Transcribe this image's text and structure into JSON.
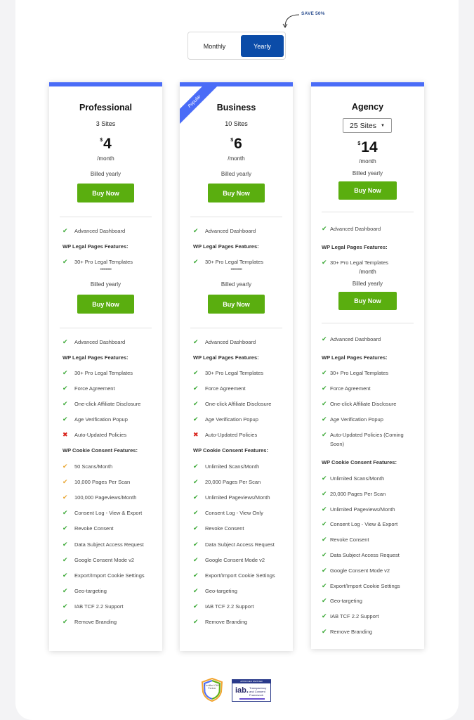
{
  "save_label": "SAVE 50%",
  "toggle": {
    "monthly": "Monthly",
    "yearly": "Yearly",
    "selected": "Yearly"
  },
  "plans": [
    {
      "title": "Professional",
      "sites": "3 Sites",
      "currency": "$",
      "price": "4",
      "per": "/month",
      "billed": "Billed yearly",
      "buy": "Buy Now",
      "preview": {
        "advanced": "Advanced Dashboard",
        "legal_heading": "WP Legal Pages Features:",
        "templates": "30+ Pro Legal Templates",
        "dots": "••••••••••",
        "billed": "Billed yearly",
        "buy": "Buy Now"
      },
      "features": {
        "advanced": "Advanced Dashboard",
        "legal_heading": "WP Legal Pages Features:",
        "legal": [
          {
            "icon": "check",
            "text": "30+ Pro Legal Templates"
          },
          {
            "icon": "check",
            "text": "Force Agreement"
          },
          {
            "icon": "check",
            "text": "One-click Affiliate Disclosure"
          },
          {
            "icon": "check",
            "text": "Age Verification Popup"
          },
          {
            "icon": "cross",
            "text": "Auto-Updated Policies"
          }
        ],
        "cookie_heading": "WP Cookie Consent Features:",
        "cookie": [
          {
            "icon": "partial",
            "text": "50 Scans/Month"
          },
          {
            "icon": "partial",
            "text": "10,000 Pages Per Scan"
          },
          {
            "icon": "partial",
            "text": "100,000 Pageviews/Month"
          },
          {
            "icon": "check",
            "text": "Consent Log - View & Export"
          },
          {
            "icon": "check",
            "text": "Revoke Consent"
          },
          {
            "icon": "check",
            "text": "Data Subject Access Request"
          },
          {
            "icon": "check",
            "text": "Google Consent Mode v2"
          },
          {
            "icon": "check",
            "text": "Export/Import Cookie Settings"
          },
          {
            "icon": "check",
            "text": "Geo-targeting"
          },
          {
            "icon": "check",
            "text": "IAB TCF 2.2 Support"
          },
          {
            "icon": "check",
            "text": "Remove Branding"
          }
        ]
      }
    },
    {
      "title": "Business",
      "ribbon": "Popular",
      "sites": "10 Sites",
      "currency": "$",
      "price": "6",
      "per": "/month",
      "billed": "Billed yearly",
      "buy": "Buy Now",
      "preview": {
        "advanced": "Advanced Dashboard",
        "legal_heading": "WP Legal Pages Features:",
        "templates": "30+ Pro Legal Templates",
        "dots": "••••••••••",
        "billed": "Billed yearly",
        "buy": "Buy Now"
      },
      "features": {
        "advanced": "Advanced Dashboard",
        "legal_heading": "WP Legal Pages Features:",
        "legal": [
          {
            "icon": "check",
            "text": "30+ Pro Legal Templates"
          },
          {
            "icon": "check",
            "text": "Force Agreement"
          },
          {
            "icon": "check",
            "text": "One-click Affiliate Disclosure"
          },
          {
            "icon": "check",
            "text": "Age Verification Popup"
          },
          {
            "icon": "cross",
            "text": "Auto-Updated Policies"
          }
        ],
        "cookie_heading": "WP Cookie Consent Features:",
        "cookie": [
          {
            "icon": "check",
            "text": "Unlimited Scans/Month"
          },
          {
            "icon": "check",
            "text": "20,000 Pages Per Scan"
          },
          {
            "icon": "check",
            "text": "Unlimited Pageviews/Month"
          },
          {
            "icon": "check",
            "text": "Consent Log - View Only"
          },
          {
            "icon": "check",
            "text": "Revoke Consent"
          },
          {
            "icon": "check",
            "text": "Data Subject Access Request"
          },
          {
            "icon": "check",
            "text": "Google Consent Mode v2"
          },
          {
            "icon": "check",
            "text": "Export/Import Cookie Settings"
          },
          {
            "icon": "check",
            "text": "Geo-targeting"
          },
          {
            "icon": "check",
            "text": "IAB TCF 2.2 Support"
          },
          {
            "icon": "check",
            "text": "Remove Branding"
          }
        ]
      }
    },
    {
      "title": "Agency",
      "sites_select": "25 Sites",
      "currency": "$",
      "price": "14",
      "per": "/month",
      "billed": "Billed yearly",
      "buy": "Buy Now",
      "preview": {
        "advanced": "Advanced Dashboard",
        "legal_heading": "WP Legal Pages Features:",
        "templates": "30+ Pro Legal Templates",
        "per": "/month",
        "billed": "Billed yearly",
        "buy": "Buy Now"
      },
      "features": {
        "advanced": "Advanced Dashboard",
        "legal_heading": "WP Legal Pages Features:",
        "legal": [
          {
            "icon": "check",
            "text": "30+ Pro Legal Templates"
          },
          {
            "icon": "check",
            "text": "Force Agreement"
          },
          {
            "icon": "check",
            "text": "One-click Affiliate Disclosure"
          },
          {
            "icon": "check",
            "text": "Age Verification Popup"
          },
          {
            "icon": "check",
            "text": "Auto-Updated Policies (Coming Soon)"
          }
        ],
        "cookie_heading": "WP Cookie Consent Features:",
        "cookie": [
          {
            "icon": "check",
            "text": "Unlimited Scans/Month"
          },
          {
            "icon": "check",
            "text": "20,000 Pages Per Scan"
          },
          {
            "icon": "check",
            "text": "Unlimited Pageviews/Month"
          },
          {
            "icon": "check",
            "text": "Consent Log - View & Export"
          },
          {
            "icon": "check",
            "text": "Revoke Consent"
          },
          {
            "icon": "check",
            "text": "Data Subject Access Request"
          },
          {
            "icon": "check",
            "text": "Google Consent Mode v2"
          },
          {
            "icon": "check",
            "text": "Export/Import Cookie Settings"
          },
          {
            "icon": "check",
            "text": "Geo-targeting"
          },
          {
            "icon": "check",
            "text": "IAB TCF 2.2 Support"
          },
          {
            "icon": "check",
            "text": "Remove Branding"
          }
        ]
      }
    }
  ],
  "badges": {
    "cmp": "Certified CMP Partner",
    "iab_top": "APPROVED PARTNER",
    "iab": "iab.",
    "iab_text": "Transparency and Consent Framework"
  },
  "colors": {
    "accent": "#4a6cf7",
    "toggle_active": "#0b4ca8",
    "buy": "#5aae0f",
    "check": "#3aa835",
    "partial": "#e8a530",
    "cross": "#d9241d"
  }
}
